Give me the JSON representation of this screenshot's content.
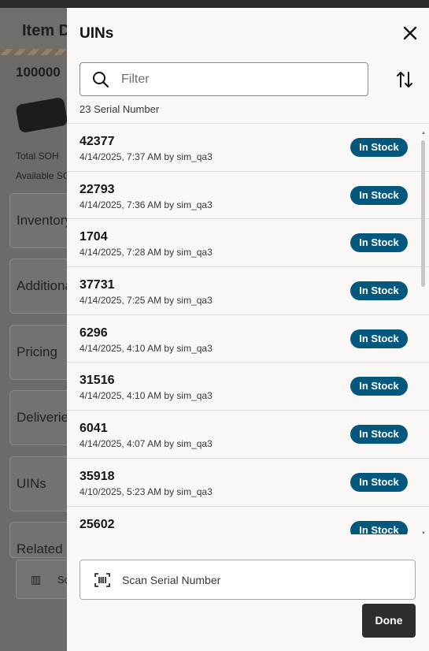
{
  "background": {
    "title": "Item D",
    "item_number": "100000",
    "total_soh_label": "Total SOH",
    "available_label": "Available SO",
    "cards": [
      "Inventory",
      "Additiona",
      "Pricing",
      "Deliverie",
      "UINs",
      "Related It"
    ],
    "scan_label": "Sc"
  },
  "drawer": {
    "title": "UINs",
    "filter": {
      "placeholder": "Filter",
      "value": ""
    },
    "count_label": "23 Serial Number",
    "items": [
      {
        "serial": "42377",
        "detail": "4/14/2025, 7:37 AM by sim_qa3",
        "status": "In Stock"
      },
      {
        "serial": "22793",
        "detail": "4/14/2025, 7:36 AM by sim_qa3",
        "status": "In Stock"
      },
      {
        "serial": "1704",
        "detail": "4/14/2025, 7:28 AM by sim_qa3",
        "status": "In Stock"
      },
      {
        "serial": "37731",
        "detail": "4/14/2025, 7:25 AM by sim_qa3",
        "status": "In Stock"
      },
      {
        "serial": "6296",
        "detail": "4/14/2025, 4:10 AM by sim_qa3",
        "status": "In Stock"
      },
      {
        "serial": "31516",
        "detail": "4/14/2025, 4:10 AM by sim_qa3",
        "status": "In Stock"
      },
      {
        "serial": "6041",
        "detail": "4/14/2025, 4:07 AM by sim_qa3",
        "status": "In Stock"
      },
      {
        "serial": "35918",
        "detail": "4/10/2025, 5:23 AM by sim_qa3",
        "status": "In Stock"
      },
      {
        "serial": "25602",
        "detail": "",
        "status": "In Stock"
      }
    ],
    "scan_button_label": "Scan Serial Number",
    "done_button_label": "Done",
    "icons": {
      "close": "close-icon",
      "search": "search-icon",
      "sort": "sort-icon",
      "barcode": "barcode-icon"
    },
    "colors": {
      "badge": "#04587d",
      "done_button": "#312d2a",
      "drawer_bg": "#f9f8f6"
    }
  }
}
